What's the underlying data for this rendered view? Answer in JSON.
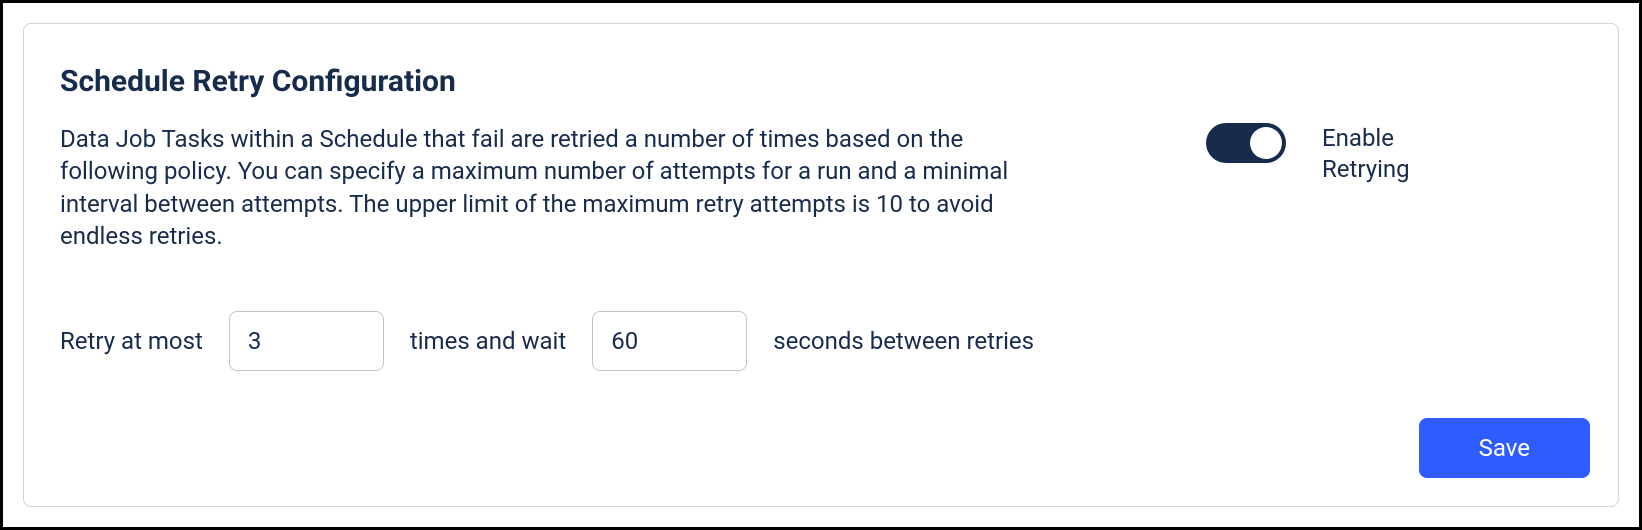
{
  "title": "Schedule Retry Configuration",
  "description": "Data Job Tasks within a Schedule that fail are retried a number of times based on the following policy. You can specify a maximum number of attempts for a run and a minimal interval between attempts. The upper limit of the maximum retry attempts is 10 to avoid endless retries.",
  "toggle": {
    "label": "Enable Retrying",
    "enabled": true
  },
  "retry": {
    "label_prefix": "Retry at most",
    "attempts": "3",
    "label_mid": "times and wait",
    "wait_seconds": "60",
    "label_suffix": "seconds between retries"
  },
  "save_label": "Save"
}
